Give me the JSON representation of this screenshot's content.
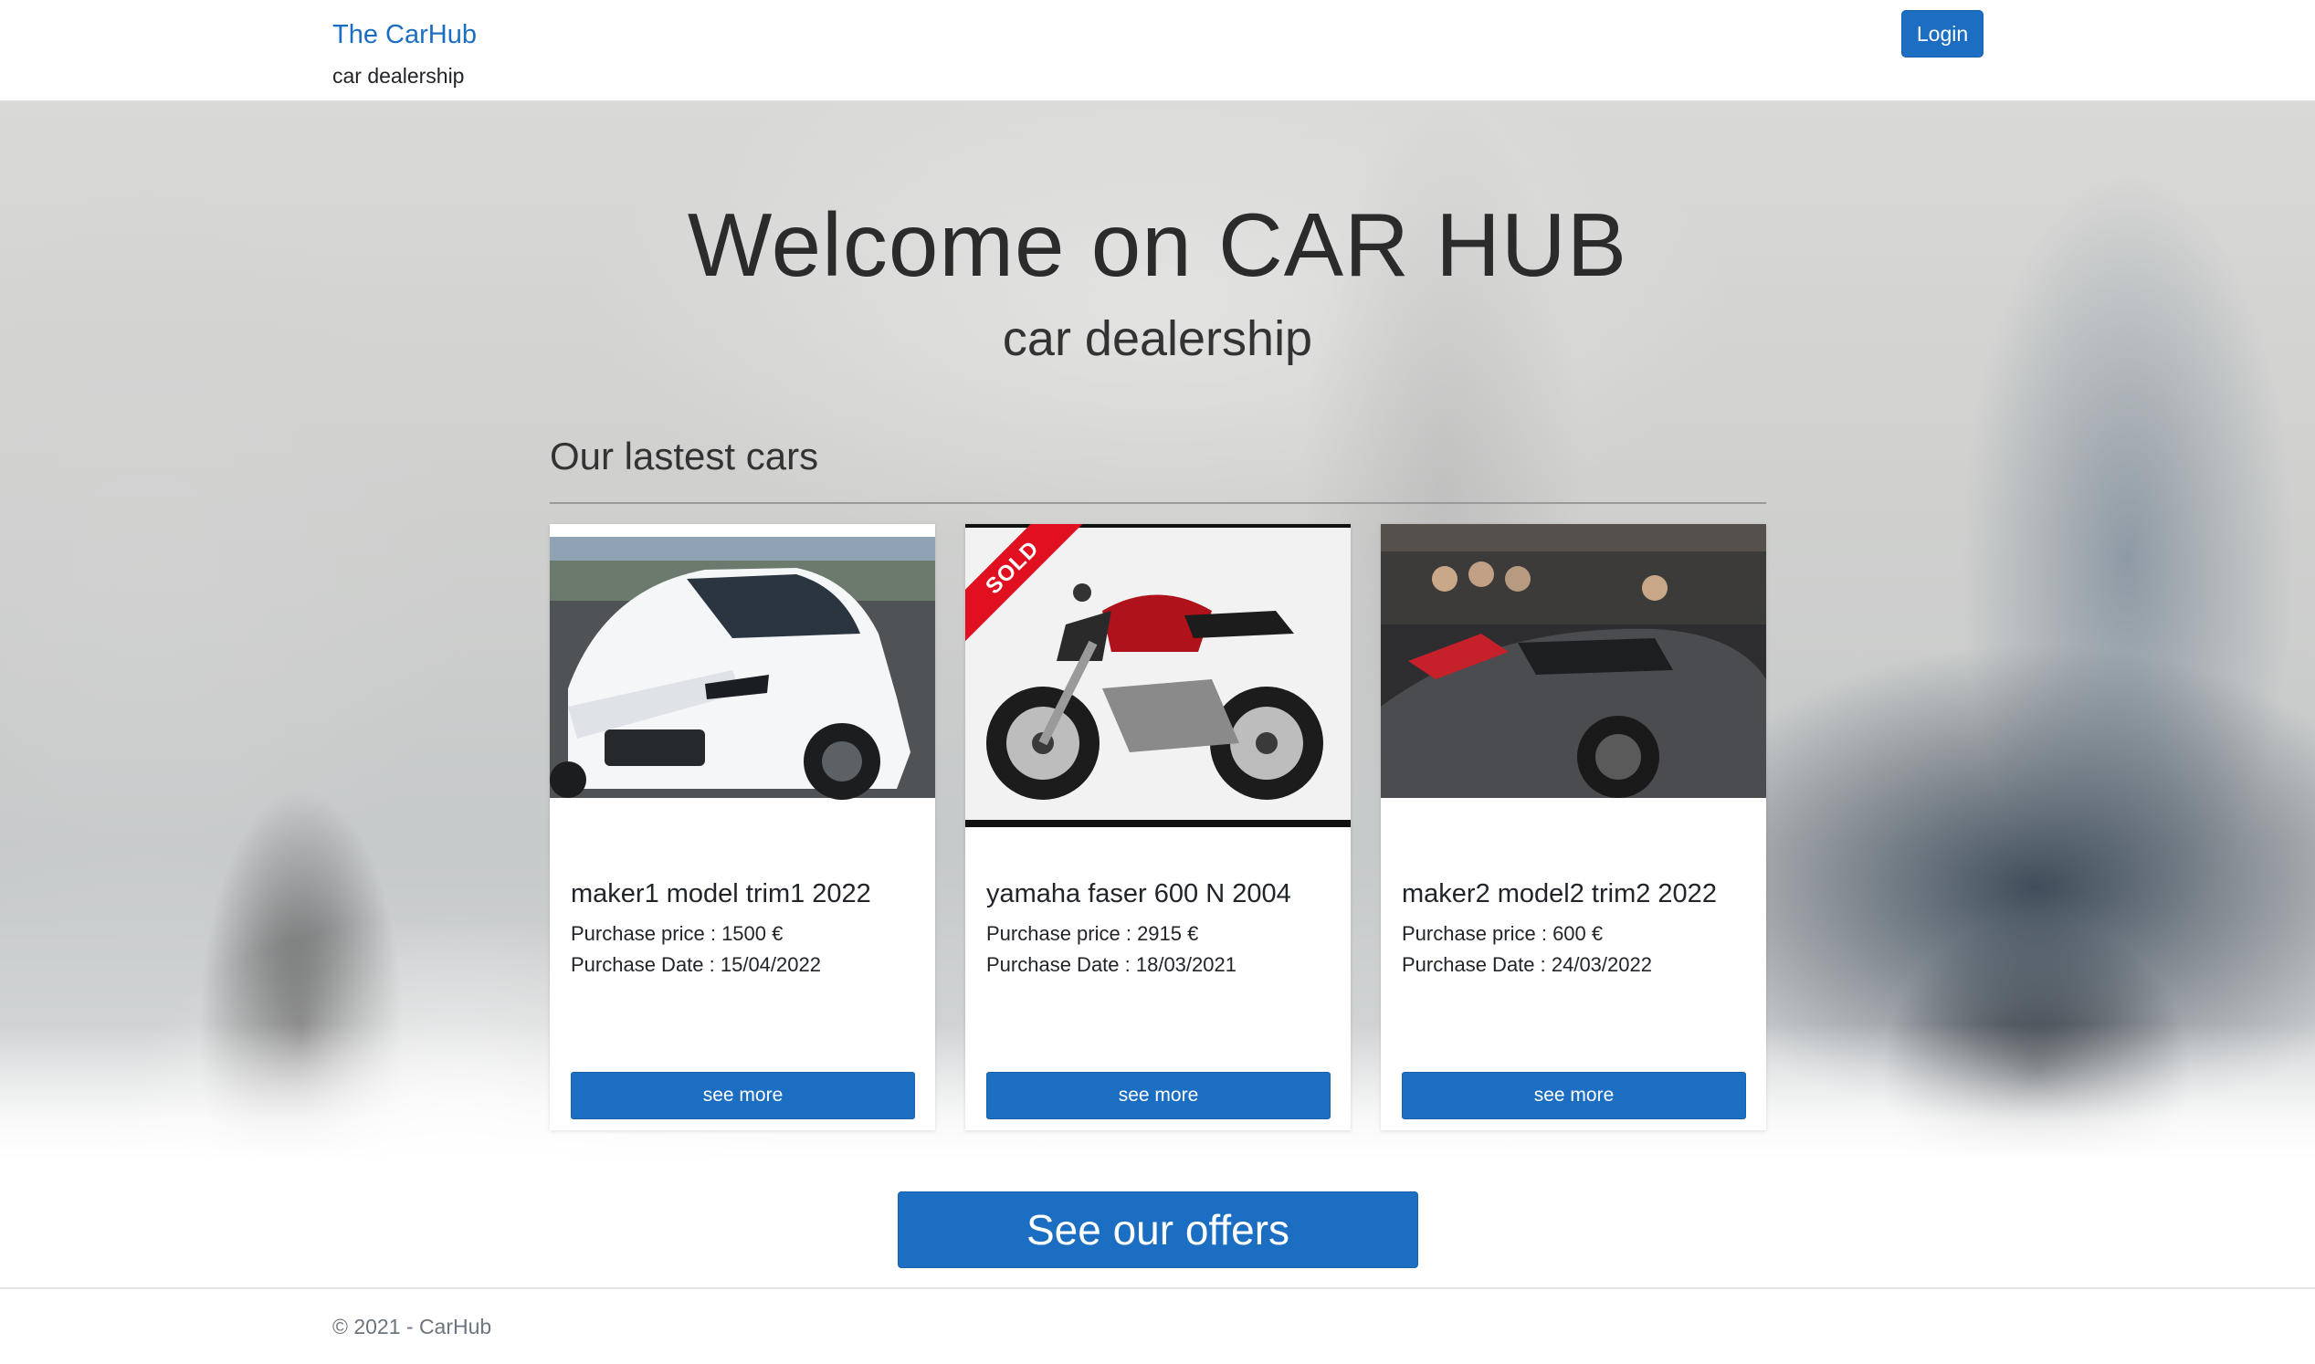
{
  "header": {
    "brand": "The CarHub",
    "brand_sub": "car dealership",
    "login_label": "Login"
  },
  "hero": {
    "title": "Welcome on CAR HUB",
    "subtitle": "car dealership",
    "section_title": "Our lastest cars"
  },
  "cars": [
    {
      "title": "maker1 model trim1 2022",
      "price": "Purchase price : 1500 €",
      "date": "Purchase Date : 15/04/2022",
      "button": "see more",
      "sold": false
    },
    {
      "title": "yamaha faser 600 N 2004",
      "price": "Purchase price : 2915 €",
      "date": "Purchase Date : 18/03/2021",
      "button": "see more",
      "sold": true,
      "sold_label": "SOLD"
    },
    {
      "title": "maker2 model2 trim2 2022",
      "price": "Purchase price : 600 €",
      "date": "Purchase Date : 24/03/2022",
      "button": "see more",
      "sold": false
    }
  ],
  "offers_button": "See our offers",
  "footer": "© 2021 - CarHub",
  "colors": {
    "primary": "#1b6ec2",
    "sold_ribbon": "#e01020"
  }
}
